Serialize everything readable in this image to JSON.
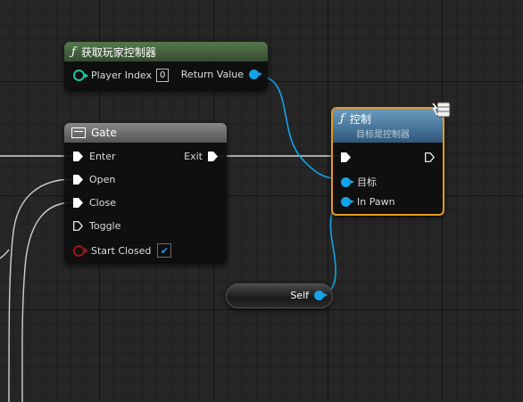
{
  "get_controller_node": {
    "title": "获取玩家控制器",
    "pin_player_index": "Player Index",
    "player_index_value": "0",
    "pin_return_value": "Return Value"
  },
  "gate_node": {
    "title": "Gate",
    "pin_enter": "Enter",
    "pin_exit": "Exit",
    "pin_open": "Open",
    "pin_close": "Close",
    "pin_toggle": "Toggle",
    "pin_start_closed": "Start Closed",
    "start_closed_checked": true
  },
  "possess_node": {
    "title": "控制",
    "subtitle": "目标是控制器",
    "pin_target": "目标",
    "pin_in_pawn": "In Pawn"
  },
  "self_node": {
    "label": "Self"
  },
  "colors": {
    "object_pin": "#12a4e8",
    "integer_pin": "#21c3a0",
    "bool_pin": "#9b1616",
    "pure_header": "#4b6a43",
    "macro_header": "#6f6f6f",
    "function_header": "#3b6a8c",
    "selection": "#e79a1d"
  }
}
